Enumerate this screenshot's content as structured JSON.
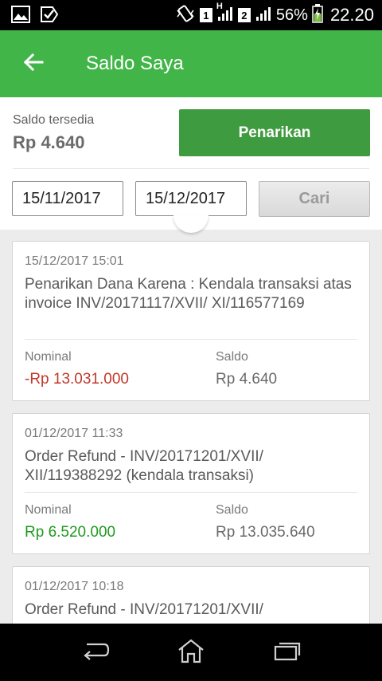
{
  "status_bar": {
    "sim1": "1",
    "sim2": "2",
    "network": "H",
    "battery": "56%",
    "time": "22.20"
  },
  "header": {
    "title": "Saldo Saya"
  },
  "balance": {
    "label": "Saldo tersedia",
    "value": "Rp 4.640",
    "withdraw_label": "Penarikan"
  },
  "filter": {
    "date_from": "15/11/2017",
    "date_to": "15/12/2017",
    "search_label": "Cari"
  },
  "columns": {
    "nominal": "Nominal",
    "saldo": "Saldo"
  },
  "transactions": [
    {
      "date": "15/12/2017 15:01",
      "description": "Penarikan Dana Karena : Kendala transaksi atas invoice INV/20171117/XVII/ XI/116577169",
      "nominal": "-Rp 13.031.000",
      "saldo": "Rp 4.640"
    },
    {
      "date": "01/12/2017 11:33",
      "description": "Order Refund - INV/20171201/XVII/ XII/119388292 (kendala transaksi)",
      "nominal": "Rp 6.520.000",
      "saldo": "Rp 13.035.640"
    },
    {
      "date": "01/12/2017 10:18",
      "description": "Order Refund - INV/20171201/XVII/",
      "nominal": "",
      "saldo": ""
    }
  ],
  "colors": {
    "primary": "#42b549",
    "button": "#3f9b3f",
    "negative": "#c0392b",
    "positive": "#1e9b1e"
  },
  "icons": {
    "back": "arrow-left-icon",
    "nav_back": "nav-back-icon",
    "nav_home": "nav-home-icon",
    "nav_recents": "nav-recents-icon"
  }
}
